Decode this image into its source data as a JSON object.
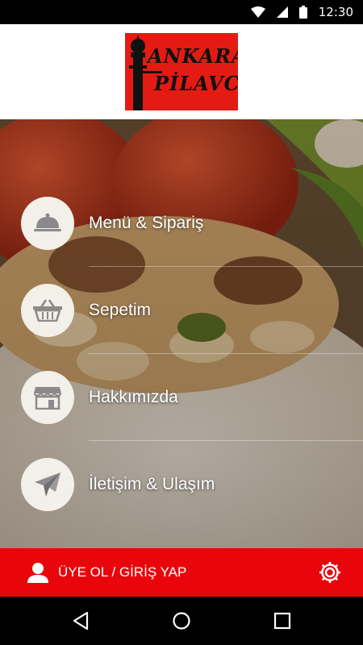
{
  "status_bar": {
    "time": "12:30",
    "icons": [
      "wifi-icon",
      "signal-icon",
      "battery-icon"
    ]
  },
  "header": {
    "logo": {
      "text_line1": "ANKARA",
      "text_line2": "PİLAVCISI",
      "background": "#e41b13"
    }
  },
  "menu": {
    "items": [
      {
        "label": "Menü & Sipariş",
        "icon": "cloche-icon"
      },
      {
        "label": "Sepetim",
        "icon": "basket-icon"
      },
      {
        "label": "Hakkımızda",
        "icon": "storefront-icon"
      },
      {
        "label": "İletişim & Ulaşım",
        "icon": "paper-plane-icon"
      }
    ]
  },
  "footer": {
    "login_label": "ÜYE OL / GİRİŞ YAP",
    "background": "#e8060c"
  },
  "nav_bar": {
    "buttons": [
      "back-icon",
      "home-icon",
      "recents-icon"
    ]
  },
  "colors": {
    "accent": "#e8060c",
    "icon_gray": "#8a8a8a"
  }
}
